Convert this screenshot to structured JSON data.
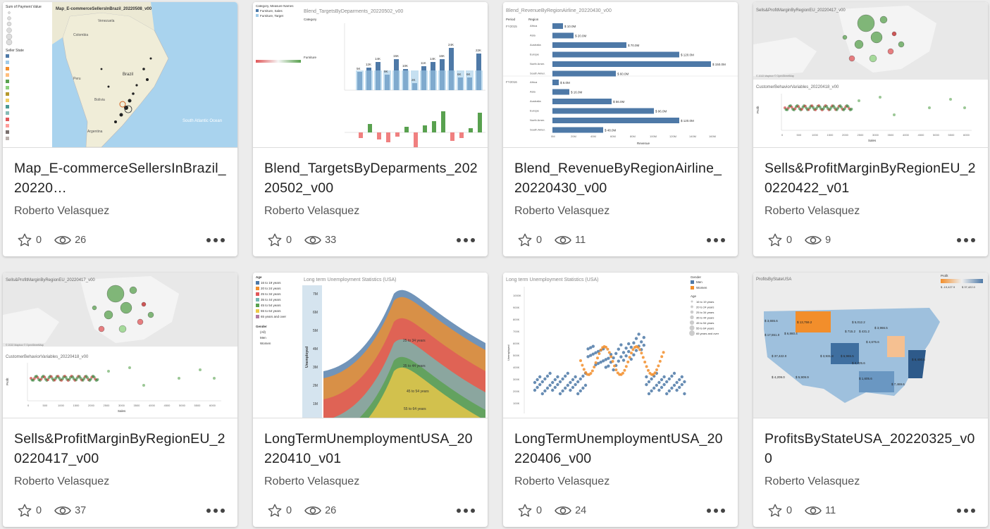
{
  "cards": [
    {
      "title": "Map_E-commerceSellersInBrazil_20220…",
      "author": "Roberto Velasquez",
      "favorites": "0",
      "views": "26",
      "thumb_title": "Map_E-commerceSellersInBrazil_20220508_v00"
    },
    {
      "title": "Blend_TargetsByDeparments_20220502_v00",
      "author": "Roberto Velasquez",
      "favorites": "0",
      "views": "33",
      "thumb_title": "Blend_TargetsByDeparments_20220502_v00"
    },
    {
      "title": "Blend_RevenueByRegionAirline_20220430_v00",
      "author": "Roberto Velasquez",
      "favorites": "0",
      "views": "11",
      "thumb_title": "Blend_RevenueByRegionAirline_20220430_v00"
    },
    {
      "title": "Sells&ProfitMarginByRegionEU_20220422_v01",
      "author": "Roberto Velasquez",
      "favorites": "0",
      "views": "9",
      "thumb_title": "Sells&ProfitMarginByRegionEU_20220417_v00"
    },
    {
      "title": "Sells&ProfitMarginByRegionEU_20220417_v00",
      "author": "Roberto Velasquez",
      "favorites": "0",
      "views": "37",
      "thumb_title": "Sells&ProfitMarginByRegionEU_20220417_v00"
    },
    {
      "title": "LongTermUnemploymentUSA_20220410_v01",
      "author": "Roberto Velasquez",
      "favorites": "0",
      "views": "26",
      "thumb_title": "Long term Unemployment Statistics (USA)"
    },
    {
      "title": "LongTermUnemploymentUSA_20220406_v00",
      "author": "Roberto Velasquez",
      "favorites": "0",
      "views": "24",
      "thumb_title": "Long term Unemployment Statistics (USA)"
    },
    {
      "title": "ProfitsByStateUSA_20220325_v00",
      "author": "Roberto Velasquez",
      "favorites": "0",
      "views": "11",
      "thumb_title": "ProfitsByStateUSA"
    }
  ],
  "thumbs": {
    "brazil": {
      "legend_title": "Sum of Payment Value",
      "legend_state": "Seller State",
      "sea_label": "South Atlantic Ocean",
      "countries": [
        "Venezuela",
        "Colombia",
        "Peru",
        "Brazil",
        "Bolivia",
        "Argentina"
      ]
    },
    "targets": {
      "legend": "Category, Measure Names",
      "items": [
        "Furniture, Sales",
        "Furniture, Target"
      ],
      "y1": "Sales vs Target",
      "y2": "Excess of Target",
      "cat": "Category",
      "furniture": "Furniture",
      "ticks1": [
        "40K",
        "30K",
        "20K",
        "10K",
        "0K"
      ],
      "ticks2": [
        "10K",
        "0K"
      ],
      "labels": [
        "5K",
        "12K",
        "14K",
        "9K",
        "15K",
        "10K",
        "2K",
        "11K",
        "14K",
        "16K",
        "24K",
        "6K",
        "6K",
        "22K"
      ]
    },
    "revenue": {
      "period": "Period",
      "region": "Region",
      "fy1": "FY2015",
      "fy2": "FY2016",
      "regions": [
        "Africa",
        "Asia",
        "Australia",
        "Europe",
        "North Amer.",
        "South Amer."
      ],
      "v1": [
        "$ 10.0M",
        "$ 20.0M",
        "$ 70.0M",
        "$ 120.0M",
        "$ 150.0M",
        "$ 60.0M"
      ],
      "v2": [
        "$ 6.0M",
        "$ 16.0M",
        "$ 56.0M",
        "$ 96.0M",
        "$ 120.0M",
        "$ 48.0M"
      ],
      "axis": [
        "0M",
        "20M",
        "40M",
        "60M",
        "80M",
        "100M",
        "120M",
        "140M",
        "160M"
      ],
      "xlabel": "Revenue"
    },
    "eu": {
      "sub": "CustomerBehaviorVariables_20220418_v00",
      "xlabel": "Sales",
      "ylabel": "Profit",
      "xticks": [
        "0",
        "500",
        "1000",
        "1500",
        "2000",
        "2500",
        "3000",
        "3500",
        "4000",
        "4500",
        "5000",
        "5500",
        "6000"
      ],
      "copyright": "© 2022 Mapbox © OpenStreetMap"
    },
    "unemp": {
      "age": "Age",
      "gender": "Gender",
      "ylabel": "Unemployed",
      "ages": [
        "16 to 19 years",
        "20 to 24 years",
        "25 to 34 years",
        "35 to 44 years",
        "45 to 54 years",
        "55 to 64 years",
        "65 years and over"
      ],
      "genders": [
        "(All)",
        "Men",
        "Women"
      ],
      "yticks": [
        "7M",
        "6M",
        "5M",
        "4M",
        "3M",
        "2M",
        "1M"
      ]
    },
    "scatter": {
      "gender": "Gender",
      "men": "Men",
      "women": "Women",
      "age": "Age",
      "ylabel": "Unemployed",
      "yticks": [
        "1000K",
        "900K",
        "800K",
        "700K",
        "600K",
        "500K",
        "400K",
        "300K",
        "200K",
        "100K"
      ],
      "ages": [
        "16 to 19 years",
        "20 to 24 years",
        "25 to 34 years",
        "35 to 44 years",
        "45 to 54 years",
        "55 to 64 years",
        "65 years and over"
      ]
    },
    "profits": {
      "legend": "Profit",
      "min": "$ -19,427.9",
      "max": "$ 37,422.0",
      "labels": [
        "$ 13,759.2",
        "$ 3,655.6",
        "$ 17,551.0",
        "$ 6,860.4",
        "$ 5,012.2",
        "$ 3,966.5",
        "$ 715.2",
        "$ 431.2",
        "$ 4,675.6",
        "$ 3,931.8",
        "$ 6,965.5",
        "$ 2,725.6",
        "$ 37,422.0",
        "$ 7,469.6",
        "$ 4,209.0",
        "$ 5,909.9",
        "$ 1,605.6",
        "$ 8,400.5"
      ]
    }
  },
  "colors": {
    "accent": "#4e79a7",
    "orange": "#f28e2b",
    "green": "#59a14f",
    "red": "#e15759"
  }
}
